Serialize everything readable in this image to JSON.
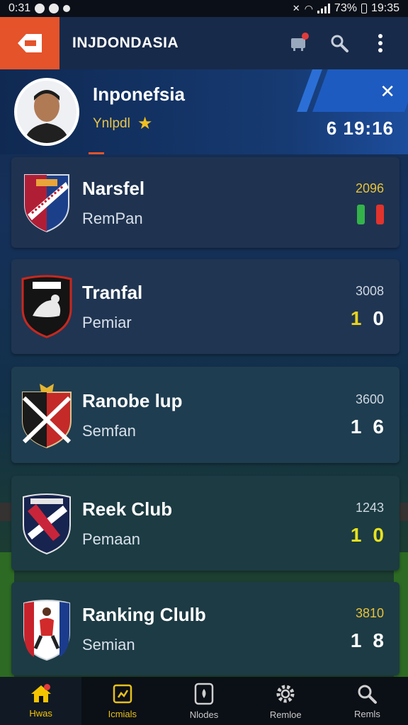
{
  "status_bar": {
    "time_left": "0:31",
    "battery": "73%",
    "time_right": "19:35"
  },
  "app_bar": {
    "title": "INJDONDASIA",
    "logo_icon": "app-logo-icon",
    "actions": [
      "cart-icon",
      "search-icon",
      "more-vert-icon"
    ]
  },
  "profile": {
    "name": "Inponefsia",
    "subtitle": "Ynlpdl",
    "star": "★",
    "score": "6 19:16",
    "close_glyph": "✕"
  },
  "teams": [
    {
      "name": "Narsfel",
      "role": "RemPan",
      "year": "2096",
      "score_a": "",
      "score_b": "",
      "year_color": "#e8c23a",
      "crest": "crest-red-blue"
    },
    {
      "name": "Tranfal",
      "role": "Pemiar",
      "year": "3008",
      "score_a": "1",
      "score_b": "0",
      "year_color": "#cfd8e2",
      "crest": "crest-black-white"
    },
    {
      "name": "Ranobe lup",
      "role": "Semfan",
      "year": "3600",
      "score_a": "1",
      "score_b": "6",
      "year_color": "#cfd8e2",
      "crest": "crest-red-black"
    },
    {
      "name": "Reek Club",
      "role": "Pemaan",
      "year": "1243",
      "score_a": "1",
      "score_b": "0",
      "year_color": "#cfd8e2",
      "crest": "crest-navy-red"
    },
    {
      "name": "Ranking Clulb",
      "role": "Semian",
      "year": "3810",
      "score_a": "1",
      "score_b": "8",
      "year_color": "#e8c23a",
      "crest": "crest-red-white-blue"
    }
  ],
  "bottom_nav": [
    {
      "label": "Hwas",
      "icon": "home-icon",
      "active": true
    },
    {
      "label": "Icmials",
      "icon": "clipboard-icon",
      "active": false
    },
    {
      "label": "Nlodes",
      "icon": "card-icon",
      "active": false
    },
    {
      "label": "Remloe",
      "icon": "gear-icon",
      "active": false
    },
    {
      "label": "Remls",
      "icon": "search-icon",
      "active": false
    }
  ]
}
